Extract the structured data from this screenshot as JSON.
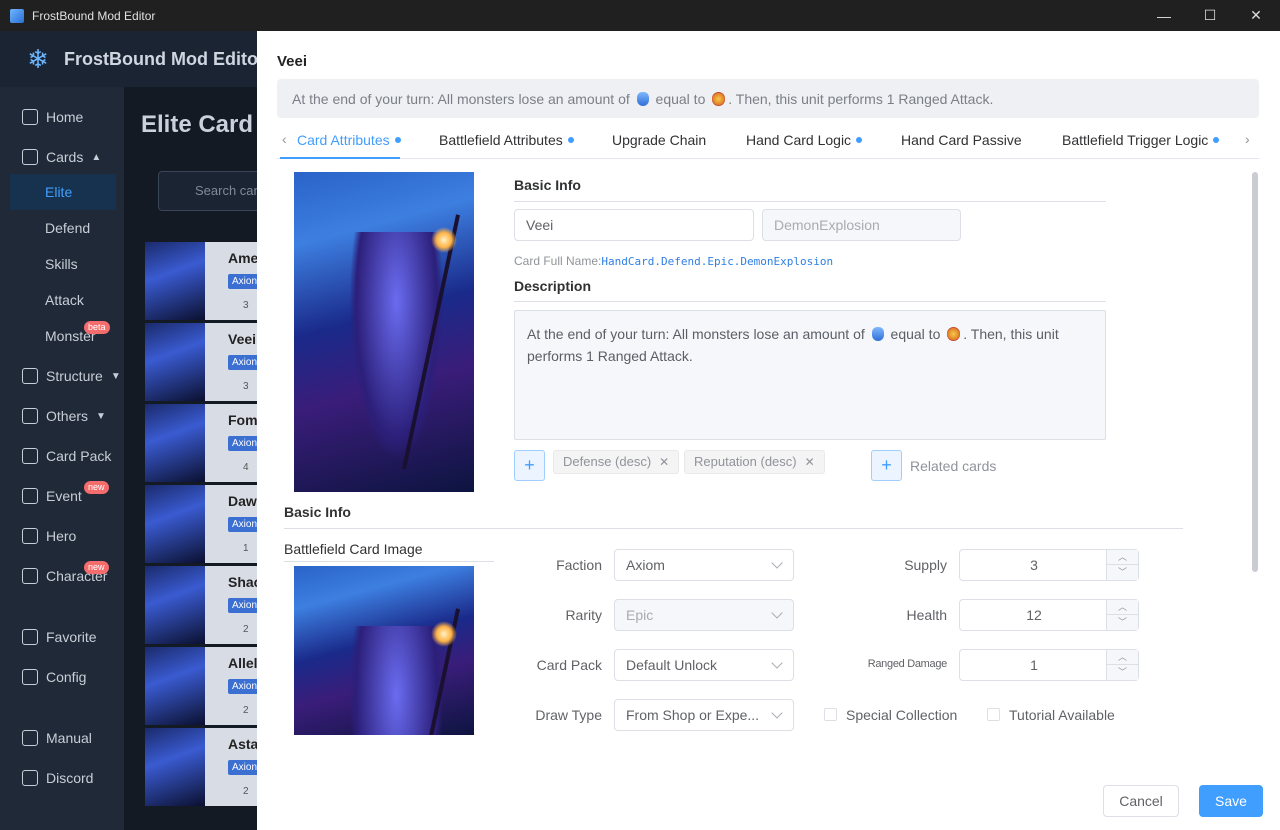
{
  "window": {
    "title": "FrostBound Mod Editor",
    "minimize": "—",
    "maximize": "☐",
    "close": "✕"
  },
  "app": {
    "brand": "FrostBound Mod Editor"
  },
  "sidebar": {
    "home": "Home",
    "cards": "Cards",
    "elite": "Elite",
    "defend": "Defend",
    "skills": "Skills",
    "attack": "Attack",
    "monster": "Monster",
    "monster_badge": "beta",
    "structure": "Structure",
    "others": "Others",
    "card_pack": "Card Pack",
    "event": "Event",
    "event_badge": "new",
    "hero": "Hero",
    "character": "Character",
    "character_badge": "new",
    "favorite": "Favorite",
    "config": "Config",
    "manual": "Manual",
    "discord": "Discord"
  },
  "background": {
    "page_title": "Elite Card",
    "search_placeholder": "Search car",
    "cards": [
      {
        "name": "Ame",
        "tag": "Axion",
        "cost": "3"
      },
      {
        "name": "Veei",
        "tag": "Axion",
        "cost": "3"
      },
      {
        "name": "Fom",
        "tag": "Axion",
        "cost": "4"
      },
      {
        "name": "Daw",
        "tag": "Axion",
        "cost": "1"
      },
      {
        "name": "Shac",
        "tag": "Axion",
        "cost": "2"
      },
      {
        "name": "Allel",
        "tag": "Axion",
        "cost": "2"
      },
      {
        "name": "Asta",
        "tag": "Axion",
        "cost": "2"
      }
    ]
  },
  "drawer": {
    "title": "Veei",
    "desc_a": "At the end of your turn: All monsters lose an amount of",
    "desc_b": "equal to",
    "desc_c": ". Then, this unit performs 1 Ranged Attack.",
    "tabs": [
      "Card Attributes",
      "Battlefield Attributes",
      "Upgrade Chain",
      "Hand Card Logic",
      "Hand Card Passive",
      "Battlefield Trigger Logic"
    ],
    "basic_info_title": "Basic Info",
    "name_value": "Veei",
    "id_value": "DemonExplosion",
    "full_name_label": "Card Full Name:",
    "full_name_value": "HandCard.Defend.Epic.DemonExplosion",
    "description_title": "Description",
    "description_a": "At the end of your turn: All monsters lose an amount of",
    "description_b": "equal to",
    "description_c": ". Then, this unit performs 1 Ranged Attack.",
    "tags": [
      "Defense (desc)",
      "Reputation (desc)"
    ],
    "related_cards": "Related cards",
    "basic_info2_title": "Basic Info",
    "battlefield_image_label": "Battlefield Card Image",
    "fields": {
      "faction_label": "Faction",
      "faction_value": "Axiom",
      "rarity_label": "Rarity",
      "rarity_value": "Epic",
      "card_pack_label": "Card Pack",
      "card_pack_value": "Default Unlock",
      "draw_type_label": "Draw Type",
      "draw_type_value": "From Shop or Expe...",
      "supply_label": "Supply",
      "supply_value": "3",
      "health_label": "Health",
      "health_value": "12",
      "ranged_damage_label": "Ranged Damage",
      "ranged_damage_value": "1",
      "special_collection_label": "Special Collection",
      "tutorial_available_label": "Tutorial Available"
    },
    "cancel": "Cancel",
    "save": "Save"
  }
}
